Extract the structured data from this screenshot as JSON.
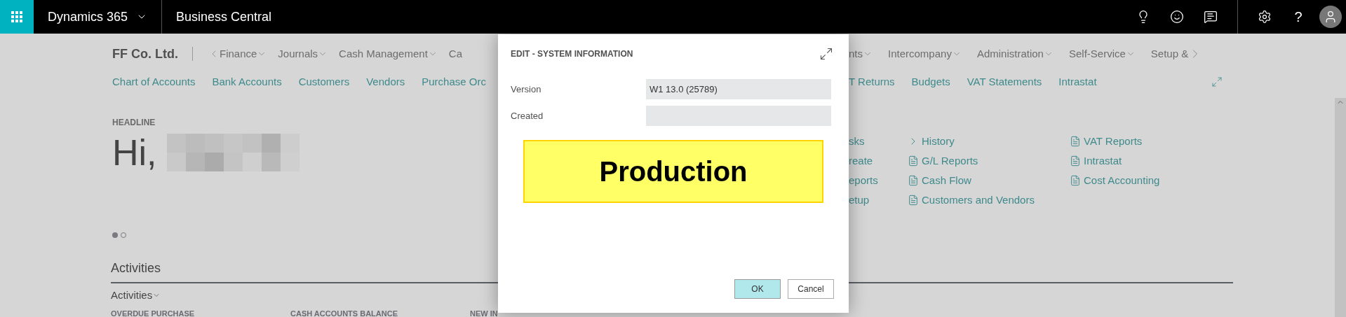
{
  "top_bar": {
    "app_name": "Dynamics 365",
    "product": "Business Central",
    "help": "?"
  },
  "company": "FF Co. Ltd.",
  "menu_left": [
    "Finance",
    "Journals",
    "Cash Management",
    "Ca"
  ],
  "menu_right": [
    "nts",
    "Intercompany",
    "Administration",
    "Self-Service",
    "Setup &"
  ],
  "quick_links_left": [
    "Chart of Accounts",
    "Bank Accounts",
    "Customers",
    "Vendors",
    "Purchase Orc"
  ],
  "quick_links_right": [
    "T Returns",
    "Budgets",
    "VAT Statements",
    "Intrastat"
  ],
  "headline": {
    "label": "HEADLINE",
    "greeting": "Hi,"
  },
  "slides": [
    {
      "selected": true
    },
    {
      "selected": false
    }
  ],
  "actions_partial": [
    "sks",
    "reate",
    "eports",
    "etup"
  ],
  "action_links": [
    {
      "kind": "folder",
      "label": "History"
    },
    {
      "kind": "report",
      "label": "G/L Reports"
    },
    {
      "kind": "report",
      "label": "Cash Flow"
    },
    {
      "kind": "report",
      "label": "Customers and Vendors"
    }
  ],
  "report_links": [
    {
      "kind": "report",
      "label": "VAT Reports"
    },
    {
      "kind": "report",
      "label": "Intrastat"
    },
    {
      "kind": "report",
      "label": "Cost Accounting"
    }
  ],
  "activities": {
    "title": "Activities",
    "group": "Activities",
    "cue_headings": [
      "OVERDUE PURCHASE",
      "CASH ACCOUNTS BALANCE",
      "NEW IN"
    ]
  },
  "dialog": {
    "title": "EDIT - SYSTEM INFORMATION",
    "fields": [
      {
        "label": "Version",
        "value": "W1 13.0 (25789)"
      },
      {
        "label": "Created"
      }
    ],
    "banner": "Production",
    "buttons": [
      {
        "label": "OK",
        "kind": "primary"
      },
      {
        "label": "Cancel",
        "kind": "secondary"
      }
    ]
  }
}
